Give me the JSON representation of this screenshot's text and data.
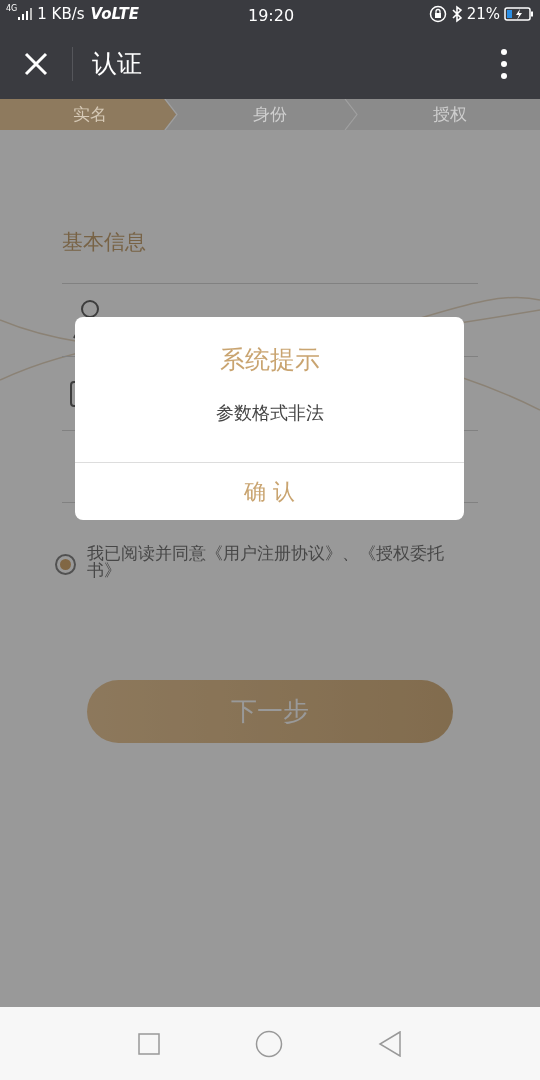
{
  "status_bar": {
    "network": "4G",
    "speed": "1 KB/s",
    "volte": "VoLTE",
    "time": "19:20",
    "battery": "21%"
  },
  "header": {
    "title": "认证"
  },
  "steps": [
    {
      "label": "实名",
      "selected": true
    },
    {
      "label": "身份",
      "selected": false
    },
    {
      "label": "授权",
      "selected": false
    }
  ],
  "form": {
    "section_title": "基本信息"
  },
  "agreement": {
    "text": "我已阅读并同意《用户注册协议》、《授权委托书》",
    "checked": true
  },
  "next_button": "下一步",
  "dialog": {
    "title": "系统提示",
    "message": "参数格式非法",
    "confirm": "确 认"
  }
}
